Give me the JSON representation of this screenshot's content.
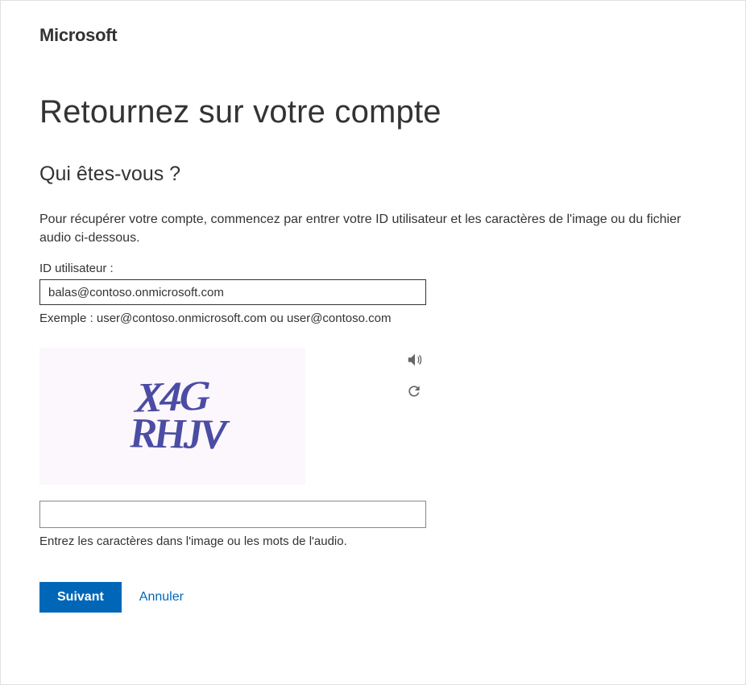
{
  "logo": "Microsoft",
  "page_title": "Retournez sur votre compte",
  "sub_heading": "Qui êtes-vous ?",
  "instructions": "Pour récupérer votre compte, commencez par entrer votre ID utilisateur et les caractères de l'image ou du fichier audio ci-dessous.",
  "user_id": {
    "label": "ID utilisateur :",
    "value": "balas@contoso.onmicrosoft.com",
    "example": "Exemple : user@contoso.onmicrosoft.com ou user@contoso.com"
  },
  "captcha": {
    "line1": "X4G",
    "line2": "RHJV",
    "input_value": "",
    "hint": "Entrez les caractères dans l'image ou les mots de l'audio."
  },
  "buttons": {
    "next": "Suivant",
    "cancel": "Annuler"
  }
}
